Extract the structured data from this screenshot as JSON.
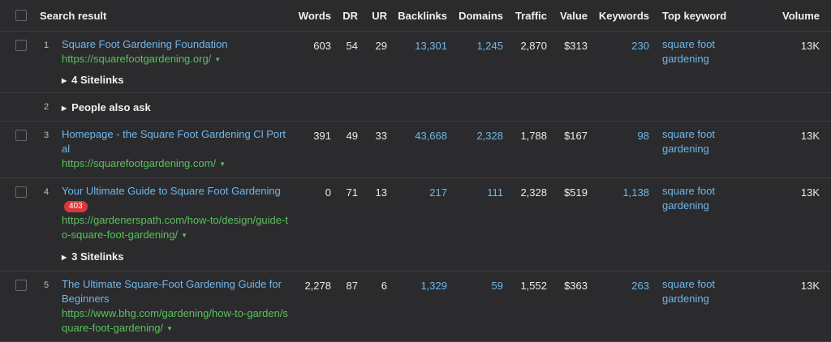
{
  "header": {
    "search_result": "Search result",
    "words": "Words",
    "dr": "DR",
    "ur": "UR",
    "backlinks": "Backlinks",
    "domains": "Domains",
    "traffic": "Traffic",
    "value": "Value",
    "keywords": "Keywords",
    "top_keyword": "Top keyword",
    "volume": "Volume"
  },
  "rows": [
    {
      "num": "1",
      "title": "Square Foot Gardening Foundation",
      "url": "https://squarefootgardening.org/",
      "words": "603",
      "dr": "54",
      "ur": "29",
      "backlinks": "13,301",
      "domains": "1,245",
      "traffic": "2,870",
      "value": "$313",
      "keywords": "230",
      "top_keyword": "square foot gardening",
      "volume": "13K",
      "sitelinks": "4 Sitelinks"
    },
    {
      "num": "2",
      "label": "People also ask"
    },
    {
      "num": "3",
      "title": "Homepage - the Square Foot Gardening Cl Portal",
      "url": "https://squarefootgardening.com/",
      "words": "391",
      "dr": "49",
      "ur": "33",
      "backlinks": "43,668",
      "domains": "2,328",
      "traffic": "1,788",
      "value": "$167",
      "keywords": "98",
      "top_keyword": "square foot gardening",
      "volume": "13K"
    },
    {
      "num": "4",
      "title": "Your Ultimate Guide to Square Foot Gardening",
      "badge": "403",
      "url": "https://gardenerspath.com/how-to/design/guide-to-square-foot-gardening/",
      "words": "0",
      "dr": "71",
      "ur": "13",
      "backlinks": "217",
      "domains": "111",
      "traffic": "2,328",
      "value": "$519",
      "keywords": "1,138",
      "top_keyword": "square foot gardening",
      "volume": "13K",
      "sitelinks": "3 Sitelinks"
    },
    {
      "num": "5",
      "title": "The Ultimate Square-Foot Gardening Guide for Beginners",
      "url": "https://www.bhg.com/gardening/how-to-garden/square-foot-gardening/",
      "words": "2,278",
      "dr": "87",
      "ur": "6",
      "backlinks": "1,329",
      "domains": "59",
      "traffic": "1,552",
      "value": "$363",
      "keywords": "263",
      "top_keyword": "square foot gardening",
      "volume": "13K"
    }
  ]
}
